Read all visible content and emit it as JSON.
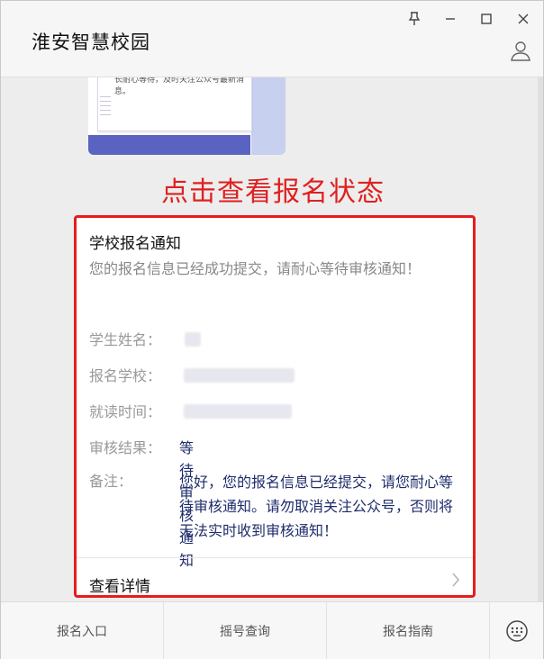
{
  "window": {
    "title": "淮安智慧校园",
    "controls": [
      "pin-icon",
      "minimize-icon",
      "maximize-icon",
      "close-icon"
    ]
  },
  "prev_message": {
    "snippet": "长耐心等待，及时关注公众号最新消息。"
  },
  "caption": "点击查看报名状态",
  "notice": {
    "title": "学校报名通知",
    "desc": "您的报名信息已经成功提交，请耐心等待审核通知！",
    "fields": {
      "name_label": "学生姓名：",
      "school_label": "报名学校：",
      "time_label": "就读时间：",
      "result_label": "审核结果：",
      "result_value": "等待审核通知",
      "remark_label": "备注：",
      "remark_value": "您好，您的报名信息已经提交，请您耐心等待审核通知。请勿取消关注公众号，否则将无法实时收到审核通知！"
    },
    "detail_label": "查看详情"
  },
  "bottom_menu": [
    "报名入口",
    "摇号查询",
    "报名指南"
  ],
  "colors": {
    "accent_red": "#e81c1c",
    "value_blue": "#1f2d6b"
  }
}
